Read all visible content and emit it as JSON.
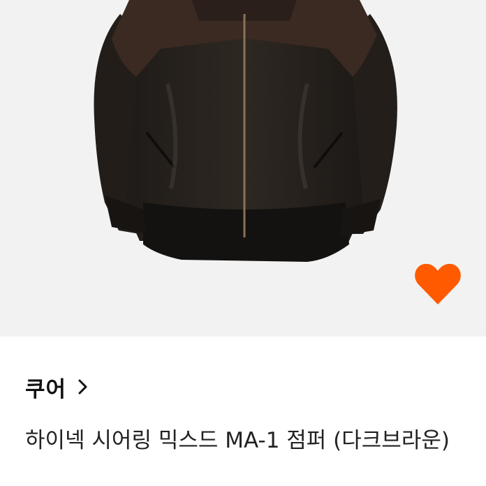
{
  "product": {
    "image_alt": "dark brown bomber jacket",
    "brand": "쿠어",
    "title": "하이넥 시어링 믹스드 MA-1 점퍼 (다크브라운)"
  },
  "icons": {
    "like": "heart-icon",
    "brand_link": "chevron-right-icon"
  },
  "colors": {
    "image_bg": "#f2f2f2",
    "heart": "#ff5a00",
    "text": "#222222"
  }
}
